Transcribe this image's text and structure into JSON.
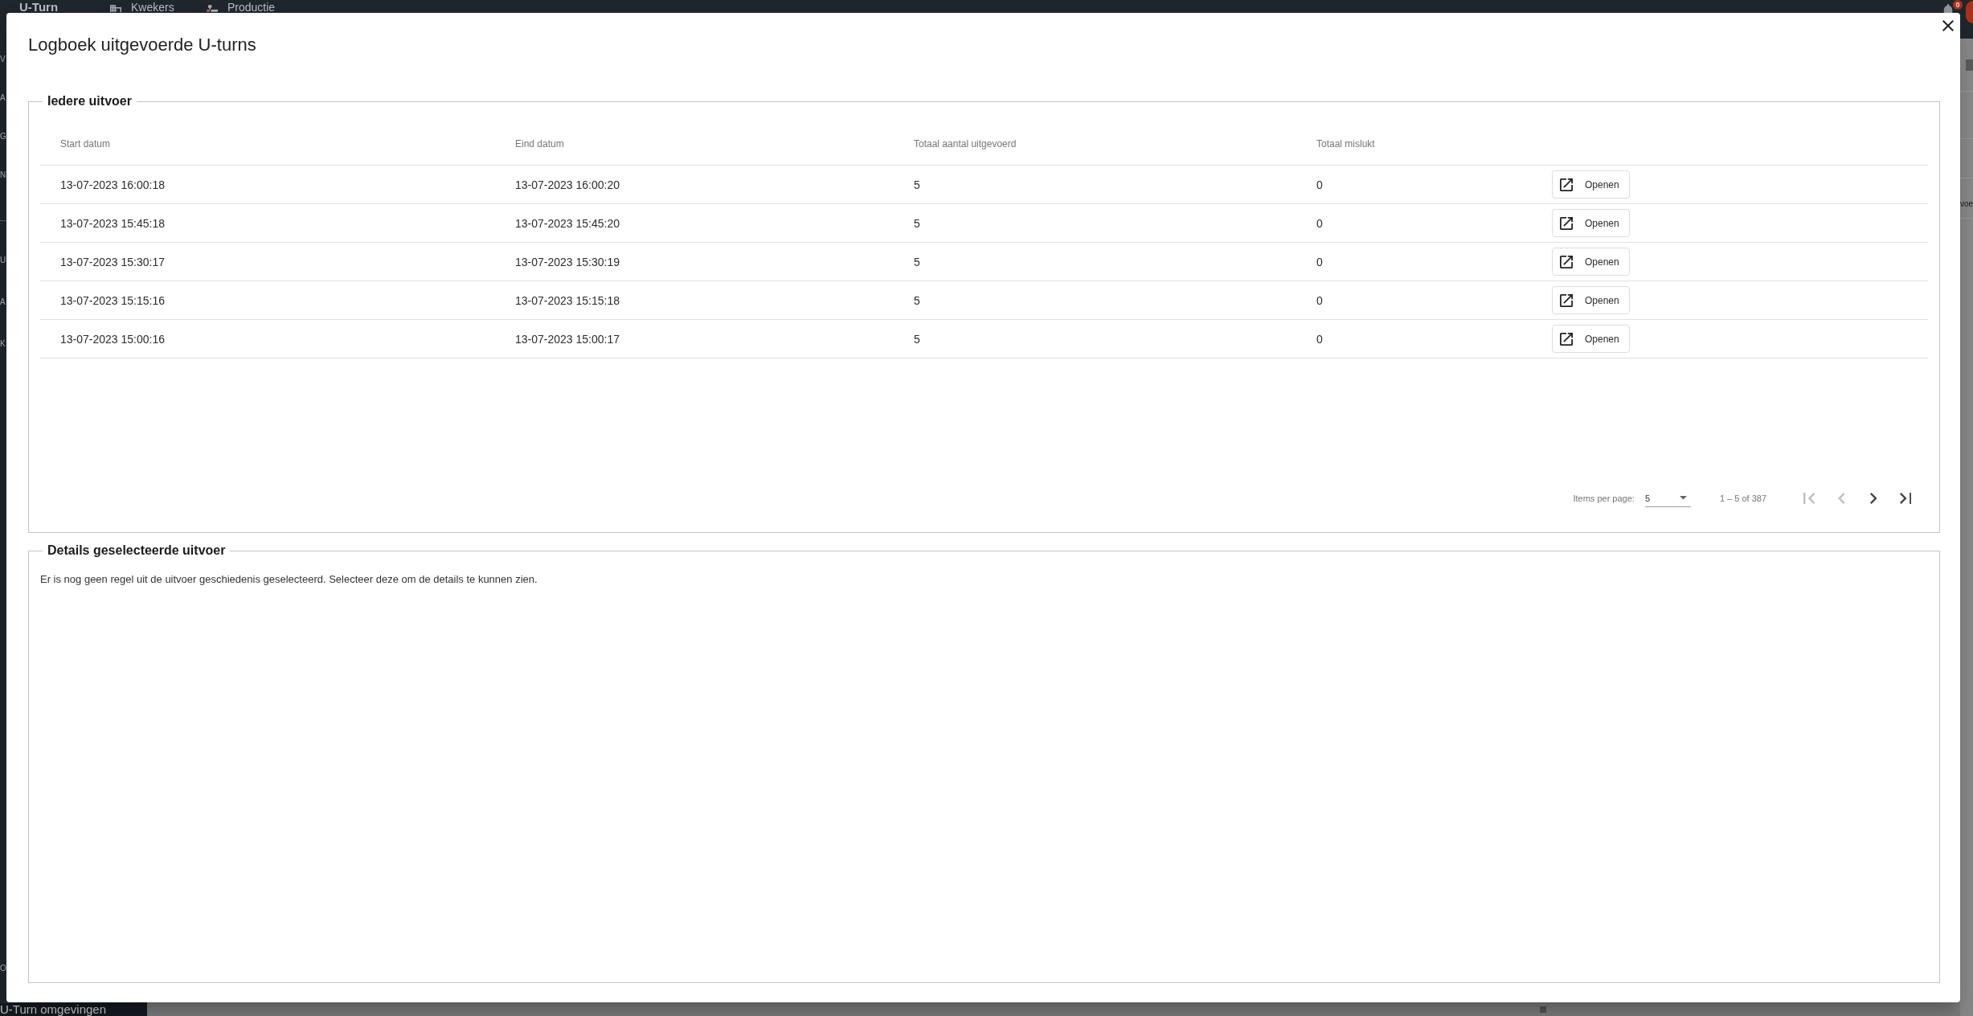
{
  "background_app": {
    "top_bar": {
      "brand": "U-Turn",
      "nav_items": [
        "Kwekers",
        "Productie"
      ],
      "notification_count": "0"
    },
    "sidebar": {
      "groups": [
        [
          "V",
          "A",
          "G",
          "N"
        ],
        [
          "U",
          "A",
          "K"
        ]
      ],
      "bottom_item": "O",
      "footer": "U-Turn omgevingen"
    },
    "side_panel": {
      "text": "voe"
    }
  },
  "dialog": {
    "title": "Logboek uitgevoerde U-turns",
    "history": {
      "legend": "Iedere uitvoer",
      "table": {
        "columns": [
          "Start datum",
          "Eind datum",
          "Totaal aantal uitgevoerd",
          "Totaal mislukt"
        ],
        "rows": [
          {
            "cells": [
              "13-07-2023 16:00:18",
              "13-07-2023 16:00:20",
              "5",
              "0"
            ],
            "action": "Openen",
            "selected": false
          },
          {
            "cells": [
              "13-07-2023 15:45:18",
              "13-07-2023 15:45:20",
              "5",
              "0"
            ],
            "action": "Openen",
            "selected": false
          },
          {
            "cells": [
              "13-07-2023 15:30:17",
              "13-07-2023 15:30:19",
              "5",
              "0"
            ],
            "action": "Openen",
            "selected": false
          },
          {
            "cells": [
              "13-07-2023 15:15:16",
              "13-07-2023 15:15:18",
              "5",
              "0"
            ],
            "action": "Openen",
            "selected": false
          },
          {
            "cells": [
              "13-07-2023 15:00:16",
              "13-07-2023 15:00:17",
              "5",
              "0"
            ],
            "action": "Openen",
            "selected": false
          }
        ]
      },
      "paginator": {
        "items_per_page_label": "Items per page:",
        "page_size": "5",
        "range": "1 – 5 of 387",
        "buttons": [
          {
            "kind": "first",
            "disabled": true
          },
          {
            "kind": "previous",
            "disabled": true
          },
          {
            "kind": "next",
            "disabled": false
          },
          {
            "kind": "last",
            "disabled": false
          }
        ]
      }
    },
    "details": {
      "legend": "Details geselecteerde uitvoer",
      "message": "Er is nog geen regel uit de uitvoer geschiedenis geselecteerd. Selecteer deze om de details te kunnen zien."
    }
  }
}
